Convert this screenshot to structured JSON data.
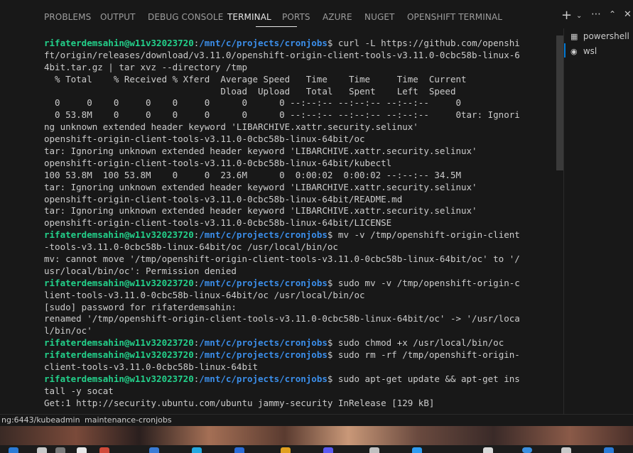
{
  "panel_tabs": [
    "PROBLEMS",
    "OUTPUT",
    "DEBUG CONSOLE",
    "TERMINAL",
    "PORTS",
    "AZURE",
    "NUGET",
    "OPENSHIFT TERMINAL"
  ],
  "active_tab": "TERMINAL",
  "toolbar_icons": [
    "plus-icon",
    "chevron-down-icon",
    "ellipsis-icon",
    "chevron-up-icon",
    "close-icon"
  ],
  "side_terminals": [
    {
      "label": "powershell",
      "icon": "terminal-icon"
    },
    {
      "label": "wsl",
      "icon": "linux-icon"
    }
  ],
  "terminal_lines": [
    {
      "user": "rifaterdemsahin@w11v32023720",
      "path": "/mnt/c/projects/cronjobs",
      "text": "$ curl -L https://github.com/openshi"
    },
    {
      "text": "ft/origin/releases/download/v3.11.0/openshift-origin-client-tools-v3.11.0-0cbc58b-linux-6"
    },
    {
      "text": "4bit.tar.gz | tar xvz --directory /tmp"
    },
    {
      "text": "  % Total    % Received % Xferd  Average Speed   Time    Time     Time  Current"
    },
    {
      "text": "                                 Dload  Upload   Total   Spent    Left  Speed"
    },
    {
      "text": "  0     0    0     0    0     0      0      0 --:--:-- --:--:-- --:--:--     0"
    },
    {
      "text": "  0 53.8M    0     0    0     0      0      0 --:--:-- --:--:-- --:--:--     0tar: Ignori"
    },
    {
      "text": "ng unknown extended header keyword 'LIBARCHIVE.xattr.security.selinux'"
    },
    {
      "text": "openshift-origin-client-tools-v3.11.0-0cbc58b-linux-64bit/oc"
    },
    {
      "text": "tar: Ignoring unknown extended header keyword 'LIBARCHIVE.xattr.security.selinux'"
    },
    {
      "text": "openshift-origin-client-tools-v3.11.0-0cbc58b-linux-64bit/kubectl"
    },
    {
      "text": "100 53.8M  100 53.8M    0     0  23.6M      0  0:00:02  0:00:02 --:--:-- 34.5M"
    },
    {
      "text": "tar: Ignoring unknown extended header keyword 'LIBARCHIVE.xattr.security.selinux'"
    },
    {
      "text": "openshift-origin-client-tools-v3.11.0-0cbc58b-linux-64bit/README.md"
    },
    {
      "text": "tar: Ignoring unknown extended header keyword 'LIBARCHIVE.xattr.security.selinux'"
    },
    {
      "text": "openshift-origin-client-tools-v3.11.0-0cbc58b-linux-64bit/LICENSE"
    },
    {
      "user": "rifaterdemsahin@w11v32023720",
      "path": "/mnt/c/projects/cronjobs",
      "text": "$ mv -v /tmp/openshift-origin-client"
    },
    {
      "text": "-tools-v3.11.0-0cbc58b-linux-64bit/oc /usr/local/bin/oc"
    },
    {
      "text": "mv: cannot move '/tmp/openshift-origin-client-tools-v3.11.0-0cbc58b-linux-64bit/oc' to '/"
    },
    {
      "text": "usr/local/bin/oc': Permission denied"
    },
    {
      "user": "rifaterdemsahin@w11v32023720",
      "path": "/mnt/c/projects/cronjobs",
      "text": "$ sudo mv -v /tmp/openshift-origin-c"
    },
    {
      "text": "lient-tools-v3.11.0-0cbc58b-linux-64bit/oc /usr/local/bin/oc"
    },
    {
      "text": "[sudo] password for rifaterdemsahin:"
    },
    {
      "text": "renamed '/tmp/openshift-origin-client-tools-v3.11.0-0cbc58b-linux-64bit/oc' -> '/usr/loca"
    },
    {
      "text": "l/bin/oc'"
    },
    {
      "user": "rifaterdemsahin@w11v32023720",
      "path": "/mnt/c/projects/cronjobs",
      "text": "$ sudo chmod +x /usr/local/bin/oc"
    },
    {
      "user": "rifaterdemsahin@w11v32023720",
      "path": "/mnt/c/projects/cronjobs",
      "text": "$ sudo rm -rf /tmp/openshift-origin-"
    },
    {
      "text": "client-tools-v3.11.0-0cbc58b-linux-64bit"
    },
    {
      "user": "rifaterdemsahin@w11v32023720",
      "path": "/mnt/c/projects/cronjobs",
      "text": "$ sudo apt-get update && apt-get ins"
    },
    {
      "text": "tall -y socat"
    },
    {
      "text": "Get:1 http://security.ubuntu.com/ubuntu jammy-security InRelease [129 kB]"
    }
  ],
  "status": {
    "cluster": "ng:6443/kubeadmin",
    "namespace": "maintenance-cronjobs"
  },
  "colors": {
    "prompt_user": "#23d18b",
    "prompt_path": "#3b8eea",
    "accent": "#0078d4"
  }
}
